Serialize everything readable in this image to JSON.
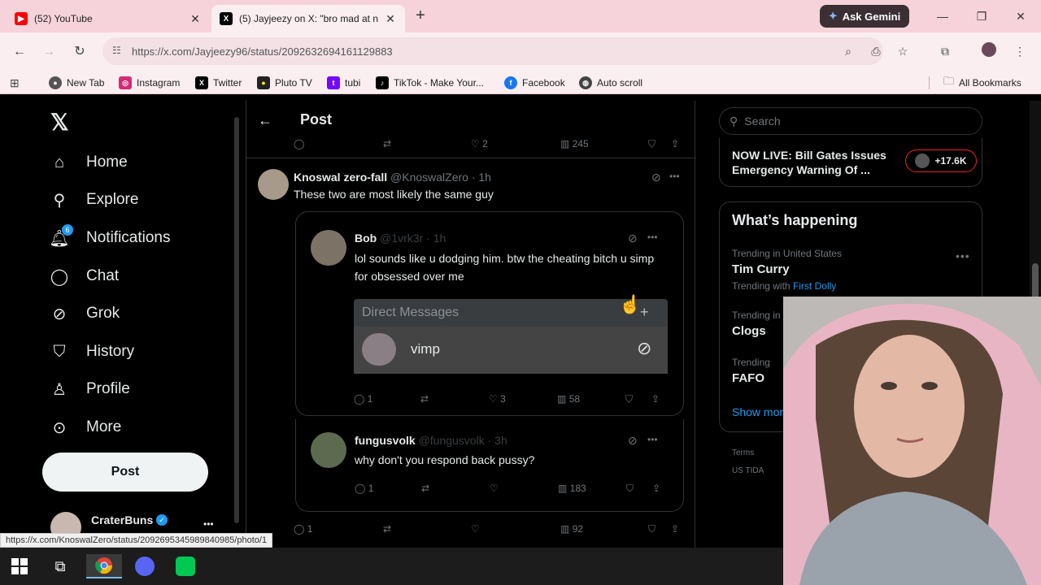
{
  "browser": {
    "tabs": [
      {
        "title": "(52) YouTube",
        "icon": "youtube-icon",
        "active": false
      },
      {
        "title": "(5) Jayjeezy on X: \"bro mad at n",
        "icon": "x-logo-icon",
        "active": true
      }
    ],
    "gemini_label": "Ask Gemini",
    "url": "https://x.com/Jayjeezy96/status/2092632694161129883",
    "bookmarks": [
      {
        "label": "New Tab",
        "icon": "chrome-icon"
      },
      {
        "label": "Instagram",
        "icon": "instagram-icon"
      },
      {
        "label": "Twitter",
        "icon": "x-logo-icon"
      },
      {
        "label": "Pluto TV",
        "icon": "pluto-icon"
      },
      {
        "label": "tubi",
        "icon": "tubi-icon"
      },
      {
        "label": "TikTok - Make Your...",
        "icon": "tiktok-icon"
      },
      {
        "label": "Facebook",
        "icon": "facebook-icon"
      },
      {
        "label": "Auto scroll",
        "icon": "globe-icon"
      }
    ],
    "all_bookmarks": "All Bookmarks",
    "status_url": "https://x.com/KnoswalZero/status/2092695345989840985/photo/1"
  },
  "nav": {
    "items": [
      {
        "label": "Home",
        "icon": "home-icon"
      },
      {
        "label": "Explore",
        "icon": "search-icon"
      },
      {
        "label": "Notifications",
        "icon": "bell-icon"
      },
      {
        "label": "Chat",
        "icon": "chat-icon"
      },
      {
        "label": "Grok",
        "icon": "grok-icon"
      },
      {
        "label": "History",
        "icon": "bookmark-icon"
      },
      {
        "label": "Profile",
        "icon": "person-icon"
      },
      {
        "label": "More",
        "icon": "more-circle-icon"
      }
    ],
    "notif_count": "6",
    "post_label": "Post",
    "account_name": "CraterBuns"
  },
  "center": {
    "header_title": "Post",
    "top_actions": {
      "likes": "2",
      "views": "245"
    },
    "reply": {
      "name": "Knoswal zero-fall",
      "handle": "@KnoswalZero",
      "time": "· 1h",
      "text": "These two are most likely the same guy"
    },
    "quote1": {
      "name": "Bob",
      "handle": "@1vrk3r",
      "time": "· 1h",
      "text": "lol sounds like u dodging him. btw the cheating bitch u simp for obsessed over me",
      "dm_header": "Direct Messages",
      "dm_name": "vimp",
      "replies": "1",
      "likes": "3",
      "views": "58"
    },
    "quote2": {
      "name": "fungusvolk",
      "handle": "@fungusvolk",
      "time": "· 3h",
      "text": "why don't you respond back pussy?",
      "replies": "1",
      "views": "183"
    },
    "bottom_actions": {
      "replies": "1",
      "views": "92"
    }
  },
  "right": {
    "search_placeholder": "Search",
    "live_text": "NOW LIVE: Bill Gates Issues Emergency Warning Of ...",
    "live_count": "+17.6K",
    "happening_title": "What’s happening",
    "trends": [
      {
        "category": "Trending in United States",
        "name": "Tim Curry",
        "sub_prefix": "Trending with ",
        "sub_link": "First Dolly"
      },
      {
        "category": "Trending in United States",
        "name": "Clogs"
      },
      {
        "category": "Trending",
        "name": "FAFO"
      }
    ],
    "show_more": "Show more",
    "footer1": "Terms",
    "footer2": "US TIDA"
  },
  "colors": {
    "accent": "#1d9bf0",
    "verified": "#1d9bf0"
  }
}
